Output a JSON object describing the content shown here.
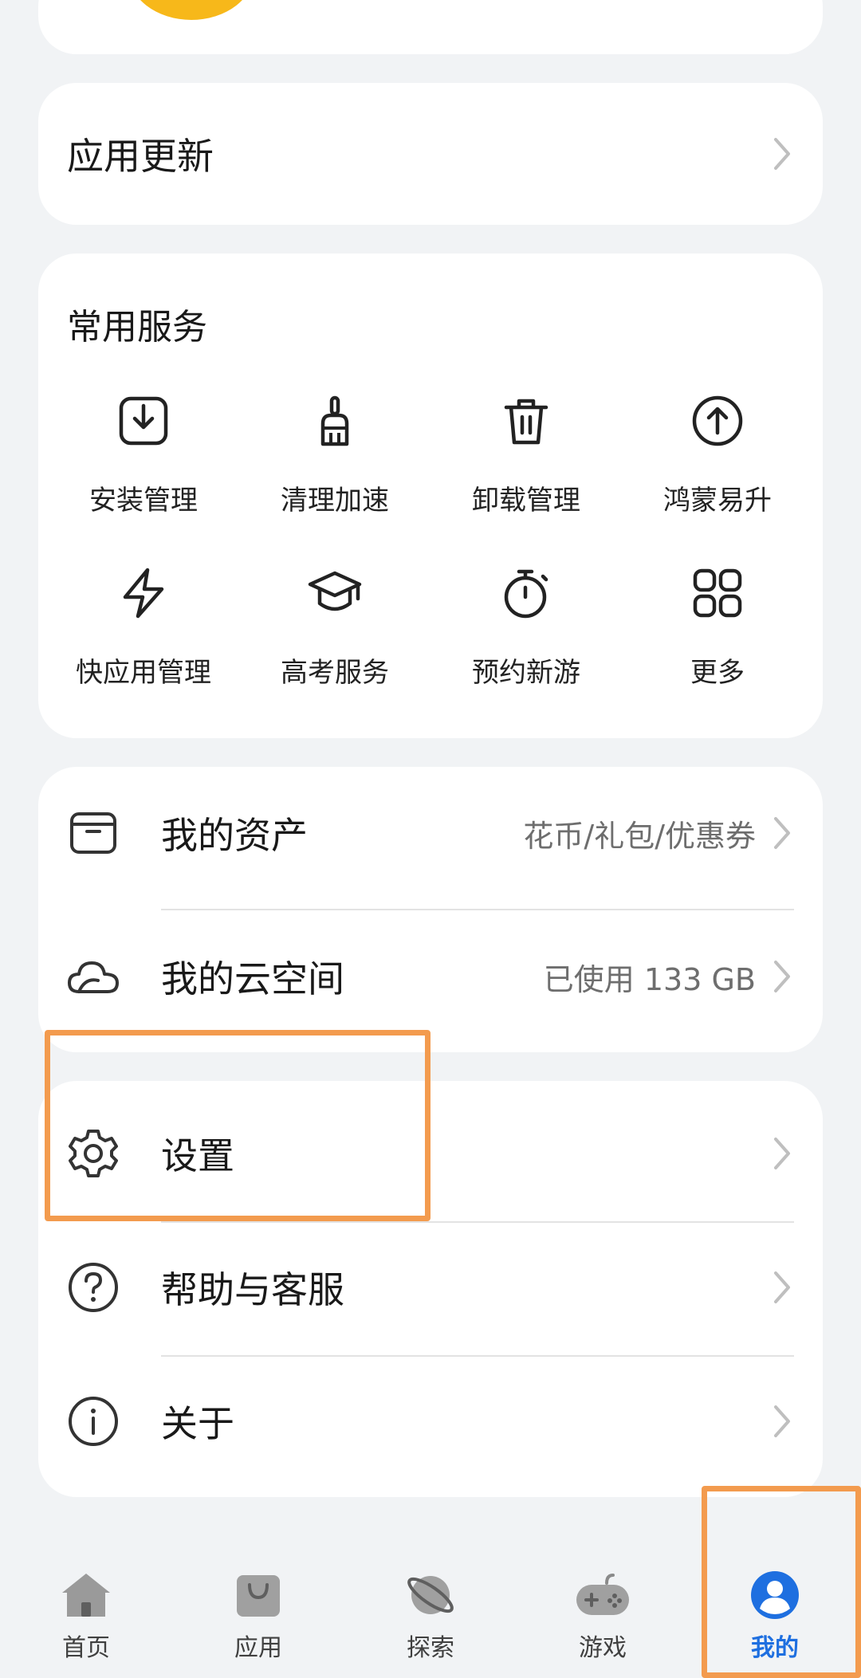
{
  "app_update": {
    "title": "应用更新"
  },
  "services": {
    "title": "常用服务",
    "items": [
      {
        "label": "安装管理",
        "icon": "install-icon"
      },
      {
        "label": "清理加速",
        "icon": "broom-icon"
      },
      {
        "label": "卸载管理",
        "icon": "trash-icon"
      },
      {
        "label": "鸿蒙易升",
        "icon": "upgrade-icon"
      },
      {
        "label": "快应用管理",
        "icon": "quick-app-icon"
      },
      {
        "label": "高考服务",
        "icon": "graduation-cap-icon"
      },
      {
        "label": "预约新游",
        "icon": "stopwatch-icon"
      },
      {
        "label": "更多",
        "icon": "grid-more-icon"
      }
    ]
  },
  "assets": {
    "my_assets": {
      "label": "我的资产",
      "value": "花币/礼包/优惠券"
    },
    "cloud": {
      "label": "我的云空间",
      "value": "已使用 133 GB"
    }
  },
  "settings_group": {
    "settings": {
      "label": "设置"
    },
    "help": {
      "label": "帮助与客服"
    },
    "about": {
      "label": "关于"
    }
  },
  "tabbar": {
    "tabs": [
      {
        "label": "首页",
        "icon": "home-icon"
      },
      {
        "label": "应用",
        "icon": "bag-icon"
      },
      {
        "label": "探索",
        "icon": "planet-icon"
      },
      {
        "label": "游戏",
        "icon": "gamepad-icon"
      },
      {
        "label": "我的",
        "icon": "profile-icon",
        "active": true
      }
    ]
  },
  "colors": {
    "accent": "#1e6fe0",
    "highlight": "#f39b4e",
    "background": "#f1f3f5"
  }
}
